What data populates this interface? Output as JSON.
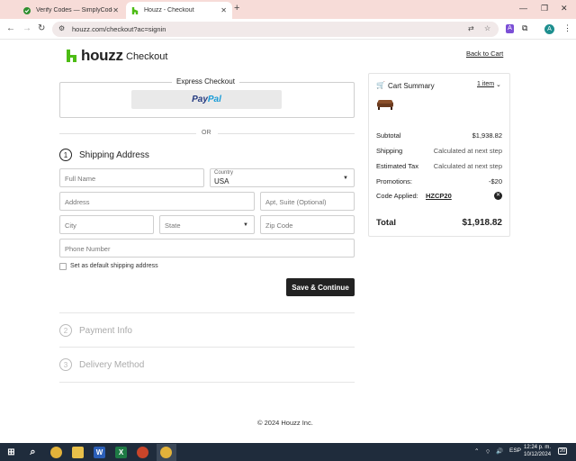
{
  "browser": {
    "tabs": [
      {
        "title": "Verify Codes — SimplyCodes",
        "active": false
      },
      {
        "title": "Houzz - Checkout",
        "active": true
      }
    ],
    "url": "houzz.com/checkout?ac=signin",
    "profile_initial": "A",
    "colors": {
      "tabbar": "#f7dcd8",
      "omnibox": "#f1e9e9"
    }
  },
  "header": {
    "logo_text": "houzz",
    "page_title": "Checkout",
    "back_link": "Back to Cart"
  },
  "express": {
    "label": "Express Checkout",
    "paypal_part1": "Pay",
    "paypal_part2": "Pal",
    "or_text": "OR"
  },
  "shipping": {
    "step_number": "1",
    "title": "Shipping Address",
    "full_name_placeholder": "Full Name",
    "country_label": "Country",
    "country_value": "USA",
    "address_placeholder": "Address",
    "apt_placeholder": "Apt, Suite (Optional)",
    "city_placeholder": "City",
    "state_placeholder": "State",
    "zip_placeholder": "Zip Code",
    "phone_placeholder": "Phone Number",
    "default_checkbox_label": "Set as default shipping address",
    "save_button": "Save & Continue"
  },
  "steps": [
    {
      "number": "2",
      "title": "Payment Info"
    },
    {
      "number": "3",
      "title": "Delivery Method"
    }
  ],
  "cart": {
    "title": "Cart Summary",
    "item_count": "1 item",
    "subtotal_label": "Subtotal",
    "subtotal": "$1,938.82",
    "shipping_label": "Shipping",
    "shipping_value": "Calculated at next step",
    "tax_label": "Estimated Tax",
    "tax_value": "Calculated at next step",
    "promotions_label": "Promotions:",
    "promotions_value": "-$20",
    "code_label": "Code Applied:",
    "code_value": "HZCP20",
    "total_label": "Total",
    "total_value": "$1,918.82"
  },
  "footer": {
    "text": "© 2024 Houzz Inc."
  },
  "taskbar": {
    "language": "ESP",
    "time": "12:24 p. m.",
    "date": "10/12/2024",
    "notification_count": "20"
  }
}
